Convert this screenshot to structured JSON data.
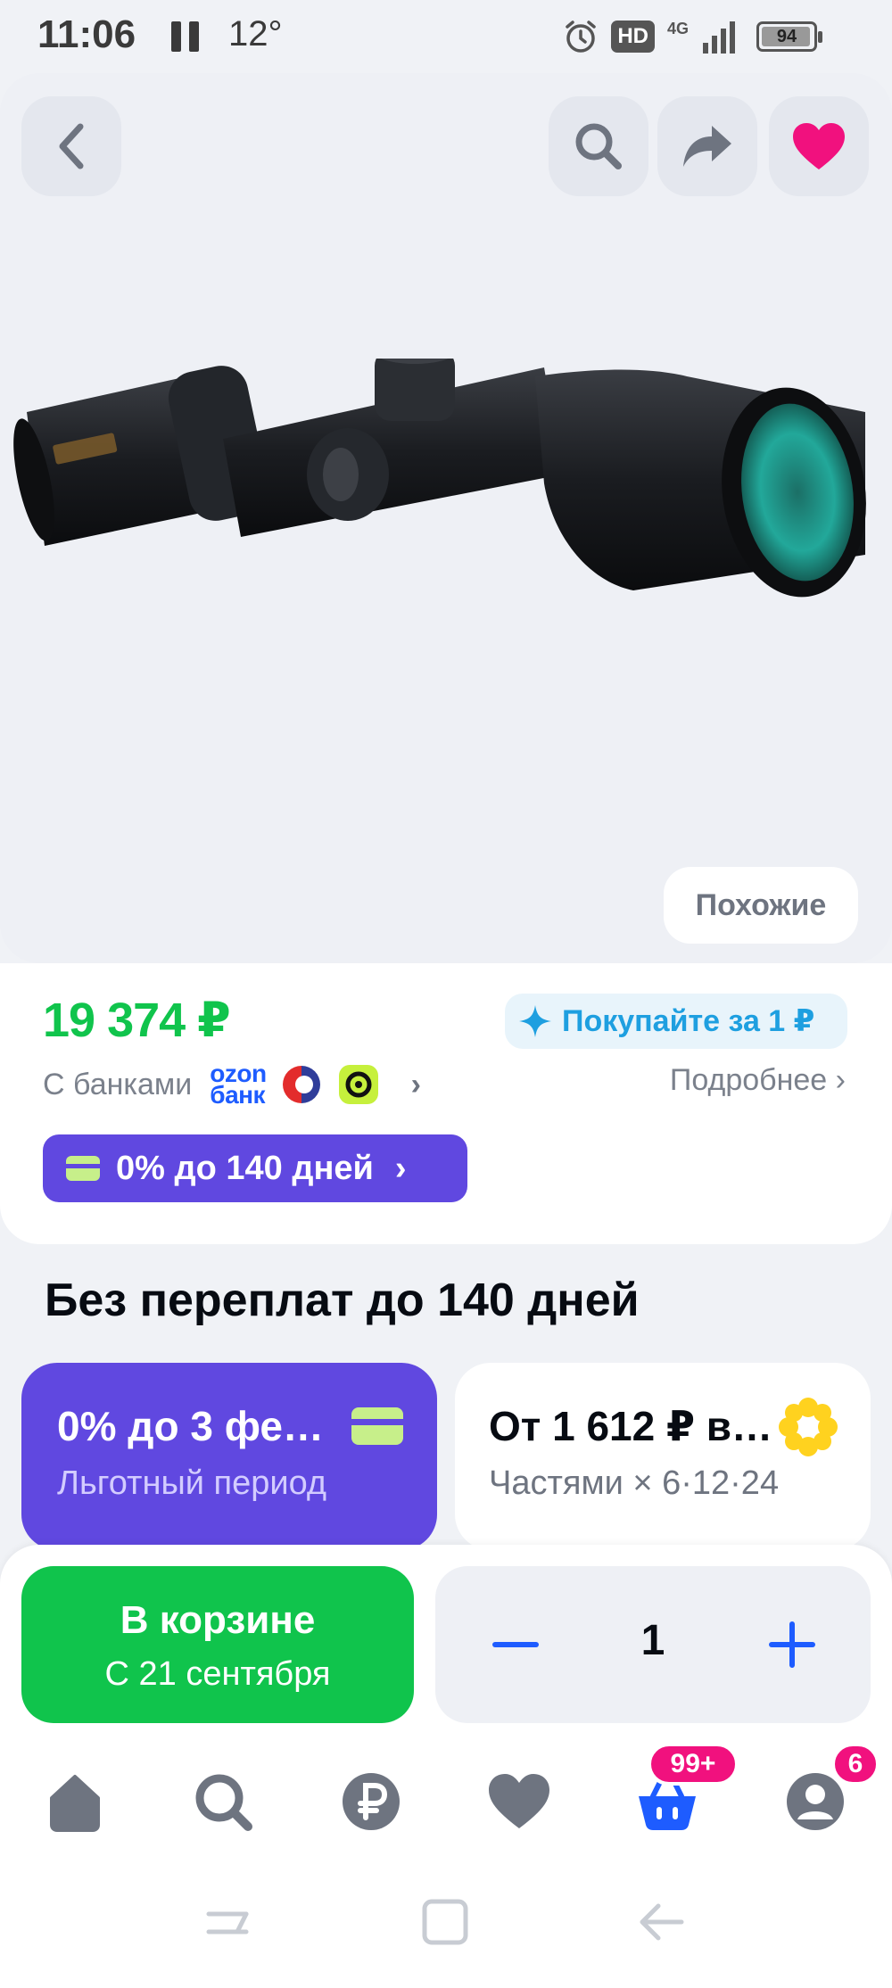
{
  "status_bar": {
    "time": "11:06",
    "temperature": "12°",
    "hd_label": "HD",
    "network": "4G",
    "battery": "94"
  },
  "gallery": {
    "back_icon": "chevron-left-icon",
    "search_icon": "search-icon",
    "share_icon": "share-arrow-icon",
    "favorite_icon": "heart-icon",
    "favorite_color": "#f1117e",
    "similar_label": "Похожие"
  },
  "price_card": {
    "price": "19 374 ₽",
    "buy_for_1_label": "Покупайте за 1 ₽",
    "banks_label": "С банками",
    "ozon_bank_line1": "ozon",
    "ozon_bank_line2": "банк",
    "more_label": "Подробнее",
    "installment_label": "0% до 140 дней"
  },
  "section": {
    "title": "Без переплат до 140 дней",
    "promo_grace": {
      "title": "0% до 3 фе…",
      "subtitle": "Льготный период"
    },
    "promo_parts": {
      "title": "От 1 612 ₽ в…",
      "subtitle": "Частями × 6·12·24"
    }
  },
  "cart": {
    "in_cart_label": "В корзине",
    "delivery_label": "С 21 сентября",
    "quantity": "1"
  },
  "bottom_nav": {
    "cart_badge": "99+",
    "profile_badge": "6",
    "active_color": "#1e5cff"
  },
  "colors": {
    "price_green": "#10c44c",
    "installment_purple": "#6048e0",
    "accent_blue": "#1e5cff",
    "badge_pink": "#f1117e"
  }
}
